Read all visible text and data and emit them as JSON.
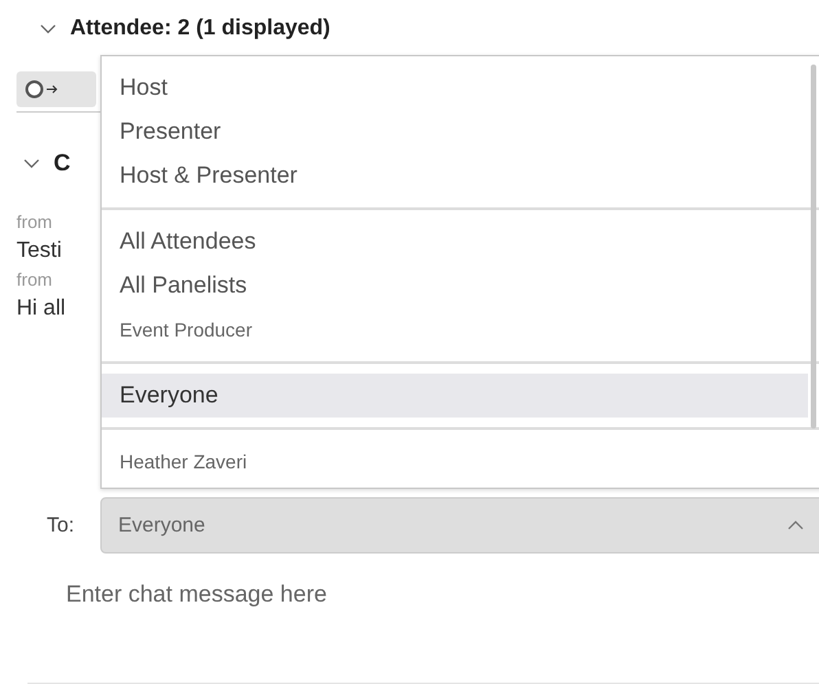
{
  "attendee_section": {
    "expanded": true,
    "title": "Attendee: 2 (1 displayed)"
  },
  "chat_section": {
    "expanded": true,
    "title": "C"
  },
  "messages": [
    {
      "sender": "from",
      "text": "Testi"
    },
    {
      "sender": "from",
      "text": "Hi all"
    }
  ],
  "recipient_menu": {
    "groups": [
      {
        "items": [
          {
            "label": "Host",
            "kind": "large",
            "selected": false
          },
          {
            "label": "Presenter",
            "kind": "large",
            "selected": false
          },
          {
            "label": "Host & Presenter",
            "kind": "large",
            "selected": false
          }
        ]
      },
      {
        "items": [
          {
            "label": "All Attendees",
            "kind": "large",
            "selected": false
          },
          {
            "label": "All Panelists",
            "kind": "large",
            "selected": false
          },
          {
            "label": "Event Producer",
            "kind": "small",
            "selected": false
          }
        ]
      },
      {
        "items": [
          {
            "label": "Everyone",
            "kind": "large",
            "selected": true
          }
        ]
      },
      {
        "items": [
          {
            "label": "Heather Zaveri",
            "kind": "small",
            "selected": false
          }
        ]
      }
    ]
  },
  "to": {
    "label": "To:",
    "value": "Everyone",
    "expanded": true
  },
  "composer": {
    "placeholder": "Enter chat message here"
  }
}
